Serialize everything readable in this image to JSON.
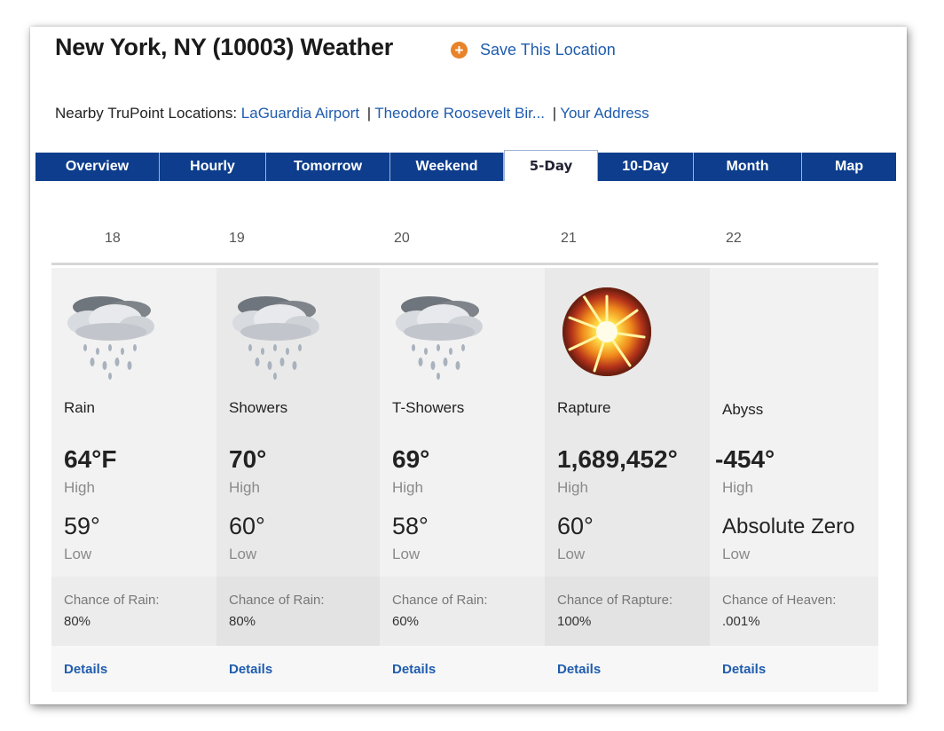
{
  "header": {
    "title": "New York, NY (10003) Weather",
    "save_label": "Save This Location",
    "save_icon": "plus-circle-icon"
  },
  "nearby": {
    "label": "Nearby TruPoint Locations:",
    "links": [
      "LaGuardia Airport",
      "Theodore Roosevelt Bir...",
      "Your Address"
    ],
    "separator": "|"
  },
  "tabs": [
    "Overview",
    "Hourly",
    "Tomorrow",
    "Weekend",
    "5-Day",
    "10-Day",
    "Month",
    "Map"
  ],
  "active_tab": "5-Day",
  "days": [
    {
      "date": "18",
      "icon": "rain-cloud-icon",
      "condition": "Rain",
      "high": "64°F",
      "high_label": "High",
      "low": "59°",
      "low_label": "Low",
      "chance_label": "Chance of Rain:",
      "chance_value": "80%",
      "details": "Details"
    },
    {
      "date": "19",
      "icon": "rain-cloud-icon",
      "condition": "Showers",
      "high": "70°",
      "high_label": "High",
      "low": "60°",
      "low_label": "Low",
      "chance_label": "Chance of Rain:",
      "chance_value": "80%",
      "details": "Details"
    },
    {
      "date": "20",
      "icon": "rain-cloud-icon",
      "condition": "T-Showers",
      "high": "69°",
      "high_label": "High",
      "low": "58°",
      "low_label": "Low",
      "chance_label": "Chance of Rain:",
      "chance_value": "60%",
      "details": "Details"
    },
    {
      "date": "21",
      "icon": "explosion-icon",
      "condition": "Rapture",
      "high": "1,689,452°",
      "high_label": "High",
      "low": "60°",
      "low_label": "Low",
      "chance_label": "Chance of Rapture:",
      "chance_value": "100%",
      "details": "Details"
    },
    {
      "date": "22",
      "icon": "",
      "condition": "Abyss",
      "high": "-454°",
      "high_label": "High",
      "low": "Absolute Zero",
      "low_label": "Low",
      "chance_label": "Chance of Heaven:",
      "chance_value": ".001%",
      "details": "Details"
    }
  ],
  "colors": {
    "tab_bar": "#0d3d8c",
    "link": "#1f5cae",
    "save_icon": "#e8832a"
  }
}
